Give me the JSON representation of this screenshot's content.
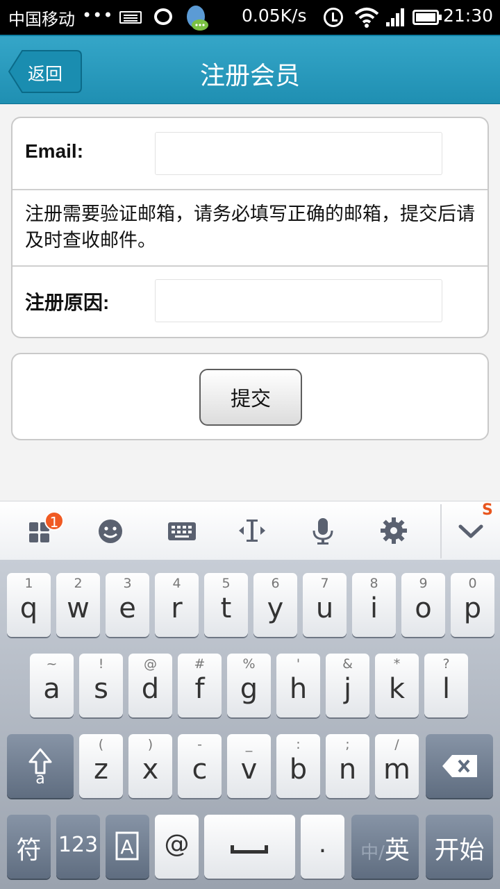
{
  "status_bar": {
    "carrier": "中国移动",
    "dots": "•••",
    "speed": "0.05K/s",
    "time": "21:30"
  },
  "header": {
    "back_label": "返回",
    "title": "注册会员"
  },
  "form": {
    "email_label": "Email:",
    "email_value": "",
    "note": "注册需要验证邮箱，请务必填写正确的邮箱，提交后请及时查收邮件。",
    "reason_label": "注册原因:",
    "reason_value": "",
    "submit_label": "提交"
  },
  "keyboard_toolbar": {
    "badge_count": "1",
    "icons": [
      "apps-icon",
      "emoji-icon",
      "keyboard-icon",
      "cursor-icon",
      "microphone-icon",
      "settings-icon",
      "collapse-icon"
    ]
  },
  "keyboard": {
    "row1": [
      {
        "hint": "1",
        "key": "q"
      },
      {
        "hint": "2",
        "key": "w"
      },
      {
        "hint": "3",
        "key": "e"
      },
      {
        "hint": "4",
        "key": "r"
      },
      {
        "hint": "5",
        "key": "t"
      },
      {
        "hint": "6",
        "key": "y"
      },
      {
        "hint": "7",
        "key": "u"
      },
      {
        "hint": "8",
        "key": "i"
      },
      {
        "hint": "9",
        "key": "o"
      },
      {
        "hint": "0",
        "key": "p"
      }
    ],
    "row2": [
      {
        "hint": "~",
        "key": "a"
      },
      {
        "hint": "!",
        "key": "s"
      },
      {
        "hint": "@",
        "key": "d"
      },
      {
        "hint": "#",
        "key": "f"
      },
      {
        "hint": "%",
        "key": "g"
      },
      {
        "hint": "'",
        "key": "h"
      },
      {
        "hint": "&",
        "key": "j"
      },
      {
        "hint": "*",
        "key": "k"
      },
      {
        "hint": "?",
        "key": "l"
      }
    ],
    "row3": [
      {
        "hint": "(",
        "key": "z"
      },
      {
        "hint": ")",
        "key": "x"
      },
      {
        "hint": "-",
        "key": "c"
      },
      {
        "hint": "_",
        "key": "v"
      },
      {
        "hint": ":",
        "key": "b"
      },
      {
        "hint": ";",
        "key": "n"
      },
      {
        "hint": "/",
        "key": "m"
      }
    ],
    "shift_sub": "a",
    "symbols_key": "符",
    "numbers_key": "123",
    "at_key": "@",
    "period_key": ".",
    "lang_dim": "中/",
    "lang_active": "英",
    "enter_key": "开始"
  },
  "colors": {
    "header": "#1f8fb2",
    "accent": "#f05a23"
  }
}
